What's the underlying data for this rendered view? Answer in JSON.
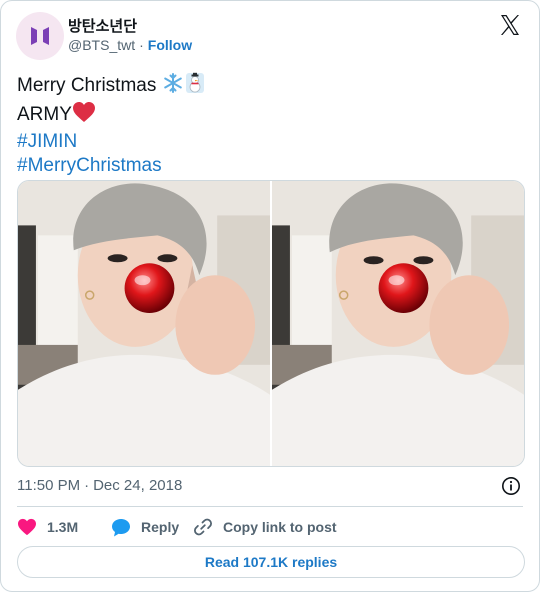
{
  "author": {
    "display_name": "방탄소년단",
    "handle": "@BTS_twt",
    "separator": "·",
    "follow_label": "Follow"
  },
  "tweet": {
    "line1": "Merry Christmas",
    "line1_emojis": [
      "❄️",
      "☃️"
    ],
    "line2": "ARMY",
    "line2_emoji": "❤️",
    "hashtags": [
      "#JIMIN",
      "#MerryChristmas"
    ]
  },
  "media": {
    "photos": [
      "photo-1",
      "photo-2"
    ]
  },
  "meta": {
    "time": "11:50 PM",
    "separator": "·",
    "date": "Dec 24, 2018"
  },
  "actions": {
    "like_count": "1.3M",
    "reply_label": "Reply",
    "copy_label": "Copy link to post"
  },
  "read_replies": "Read 107.1K replies",
  "icons": {
    "avatar": "bts-logo-icon",
    "brand": "x-logo-icon",
    "info": "info-icon",
    "like": "heart-icon",
    "reply": "speech-bubble-icon",
    "copy": "link-icon"
  },
  "colors": {
    "link": "#1d79c6",
    "like": "#f91880",
    "reply": "#1d9bf0",
    "muted": "#536471",
    "border": "#cfd9de",
    "avatar_bg": "#f5e6f1",
    "avatar_logo": "#7b3fb5"
  }
}
